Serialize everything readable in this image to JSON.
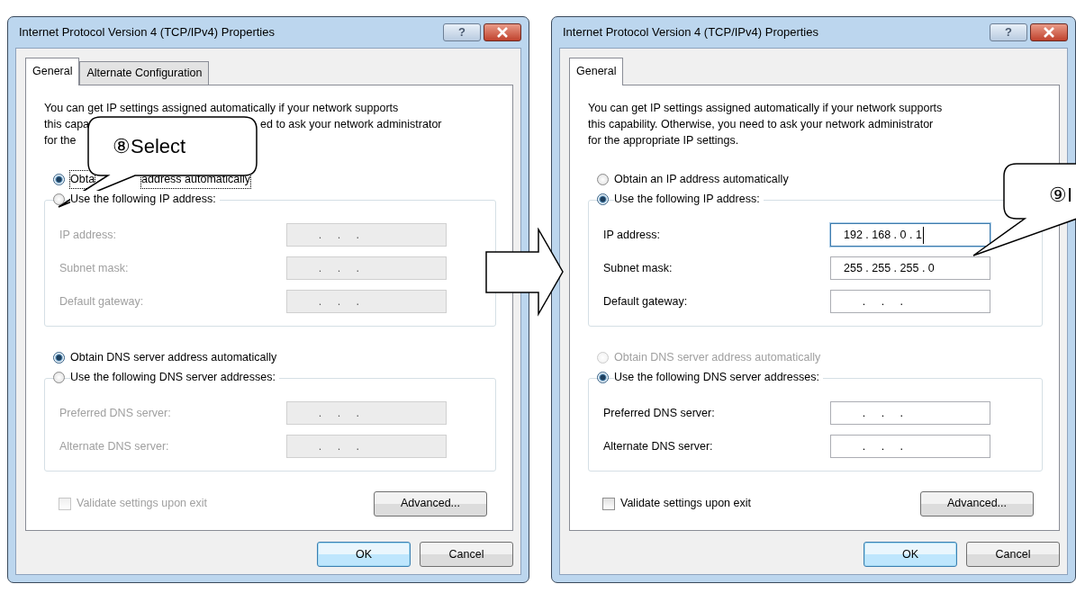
{
  "dialogs": [
    {
      "title": "Internet Protocol Version 4 (TCP/IPv4) Properties",
      "help_glyph": "?",
      "tabs": [
        {
          "label": "General",
          "selected": true
        },
        {
          "label": "Alternate Configuration",
          "selected": false
        }
      ],
      "description": [
        {
          "parts": [
            "You can get IP settings assigned automatically if your network supports"
          ]
        },
        {
          "parts": [
            "this capa",
            "ed to ask your network administrator"
          ]
        },
        {
          "parts": [
            "for the"
          ]
        }
      ],
      "sections": [
        {
          "radios": [
            {
              "parts": [
                "Obta",
                "address automatically"
              ],
              "selected": true,
              "disabled": false,
              "focused": true
            },
            {
              "parts": [
                "Use the following IP address:"
              ],
              "selected": false,
              "disabled": false,
              "focused": false
            }
          ],
          "fields": [
            {
              "label": "IP address:",
              "value": "      .     .     .",
              "disabled": true,
              "focused": false
            },
            {
              "label": "Subnet mask:",
              "value": "      .     .     .",
              "disabled": true,
              "focused": false
            },
            {
              "label": "Default gateway:",
              "value": "      .     .     .",
              "disabled": true,
              "focused": false
            }
          ]
        },
        {
          "radios": [
            {
              "parts": [
                "Obtain DNS server address automatically"
              ],
              "selected": true,
              "disabled": false,
              "focused": false
            },
            {
              "parts": [
                "Use the following DNS server addresses:"
              ],
              "selected": false,
              "disabled": false,
              "focused": false
            }
          ],
          "fields": [
            {
              "label": "Preferred DNS server:",
              "value": "      .     .     .",
              "disabled": true,
              "focused": false
            },
            {
              "label": "Alternate DNS server:",
              "value": "      .     .     .",
              "disabled": true,
              "focused": false
            }
          ]
        }
      ],
      "validate": {
        "label": "Validate settings upon exit",
        "checked": false,
        "disabled": true
      },
      "advanced_button": "Advanced...",
      "buttons": [
        {
          "label": "OK",
          "default": true
        },
        {
          "label": "Cancel",
          "default": false
        }
      ]
    },
    {
      "title": "Internet Protocol Version 4 (TCP/IPv4) Properties",
      "help_glyph": "?",
      "tabs": [
        {
          "label": "General",
          "selected": true
        }
      ],
      "description": [
        {
          "parts": [
            "You can get IP settings assigned automatically if your network supports"
          ]
        },
        {
          "parts": [
            "this capability. Otherwise, you need to ask your network administrator"
          ]
        },
        {
          "parts": [
            "for the appropriate IP settings."
          ]
        }
      ],
      "sections": [
        {
          "radios": [
            {
              "parts": [
                "Obtain an IP address automatically"
              ],
              "selected": false,
              "disabled": false,
              "focused": false
            },
            {
              "parts": [
                "Use the following IP address:"
              ],
              "selected": true,
              "disabled": false,
              "focused": false
            }
          ],
          "fields": [
            {
              "label": "IP address:",
              "value": "192 . 168 . 0 . 1",
              "disabled": false,
              "focused": true
            },
            {
              "label": "Subnet mask:",
              "value": "255 . 255 . 255 . 0",
              "disabled": false,
              "focused": false
            },
            {
              "label": "Default gateway:",
              "value": "      .     .     .",
              "disabled": false,
              "focused": false
            }
          ]
        },
        {
          "radios": [
            {
              "parts": [
                "Obtain DNS server address automatically"
              ],
              "selected": false,
              "disabled": true,
              "focused": false
            },
            {
              "parts": [
                "Use the following DNS server addresses:"
              ],
              "selected": true,
              "disabled": false,
              "focused": false
            }
          ],
          "fields": [
            {
              "label": "Preferred DNS server:",
              "value": "      .     .     .",
              "disabled": false,
              "focused": false
            },
            {
              "label": "Alternate DNS server:",
              "value": "      .     .     .",
              "disabled": false,
              "focused": false
            }
          ]
        }
      ],
      "validate": {
        "label": "Validate settings upon exit",
        "checked": false,
        "disabled": false
      },
      "advanced_button": "Advanced...",
      "buttons": [
        {
          "label": "OK",
          "default": true
        },
        {
          "label": "Cancel",
          "default": false
        }
      ]
    }
  ],
  "callouts": [
    {
      "text": "⑧Select"
    },
    {
      "text": "⑨I"
    }
  ]
}
